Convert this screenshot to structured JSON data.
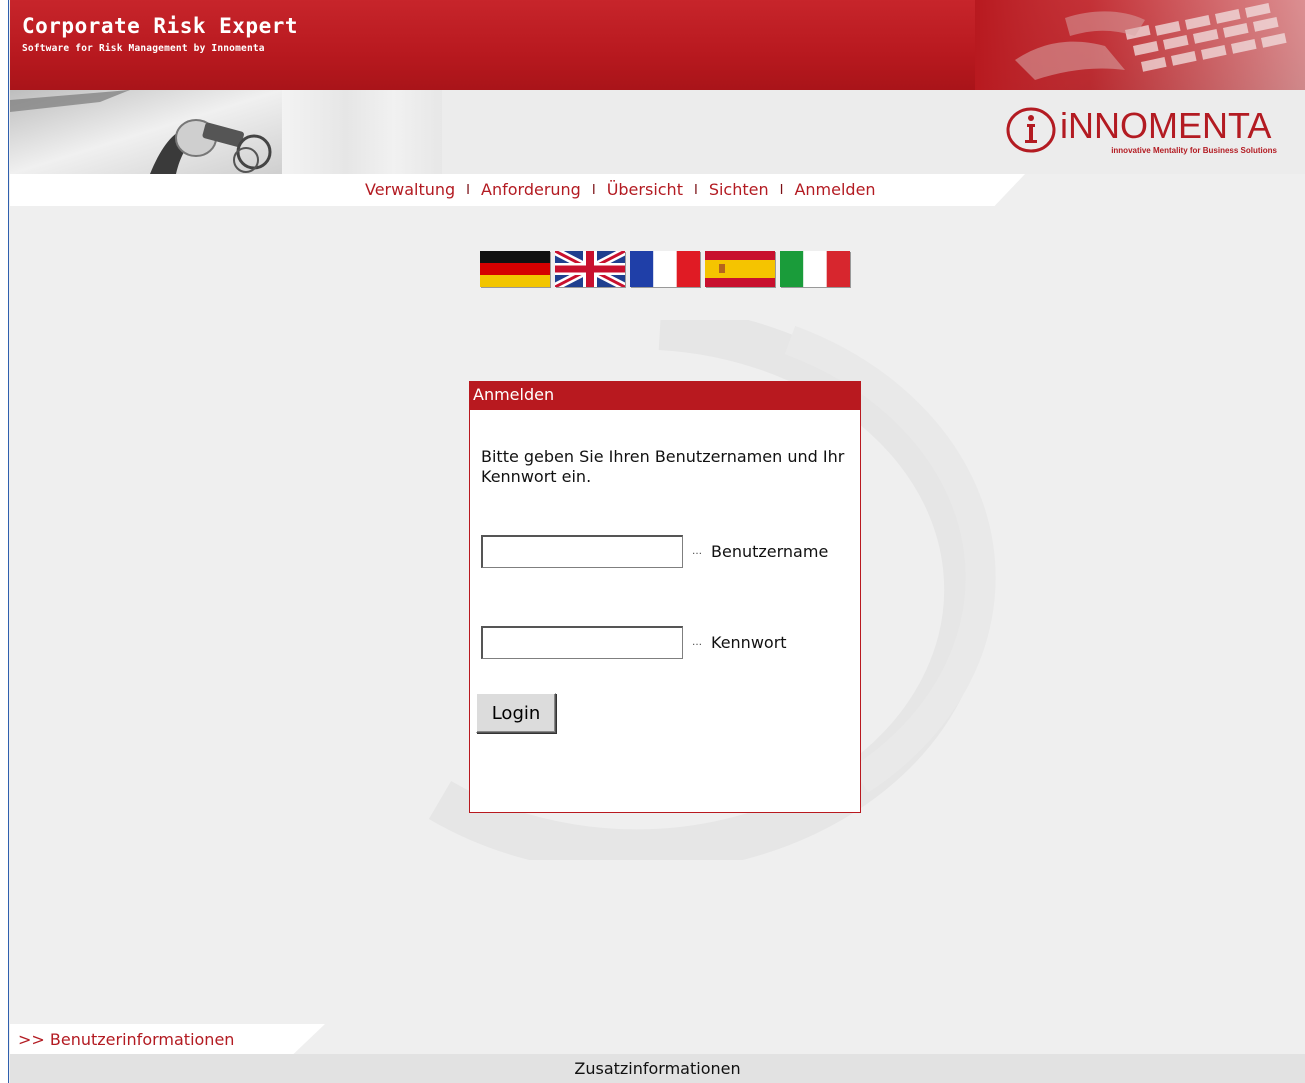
{
  "header": {
    "title": "Corporate Risk Expert",
    "subtitle": "Software for Risk Management by Innomenta"
  },
  "logo": {
    "text": "iNNOMENTA",
    "tagline": "innovative Mentality for Business Solutions",
    "brand_color": "#b31b22"
  },
  "nav": {
    "items": [
      "Verwaltung",
      "Anforderung",
      "Übersicht",
      "Sichten",
      "Anmelden"
    ],
    "separator": "I"
  },
  "flags": [
    "german-flag-icon",
    "uk-flag-icon",
    "french-flag-icon",
    "spanish-flag-icon",
    "italian-flag-icon"
  ],
  "login": {
    "heading": "Anmelden",
    "message": "Bitte geben Sie Ihren Benutzernamen und Ihr Kennwort ein.",
    "username_label": "Benutzername",
    "username_value": "",
    "password_label": "Kennwort",
    "password_value": "",
    "button_label": "Login"
  },
  "footer": {
    "tab_label": ">> Benutzerinformationen",
    "bar_label": "Zusatzinformationen"
  },
  "colors": {
    "header_red": "#b8191f",
    "background": "#efefef"
  }
}
